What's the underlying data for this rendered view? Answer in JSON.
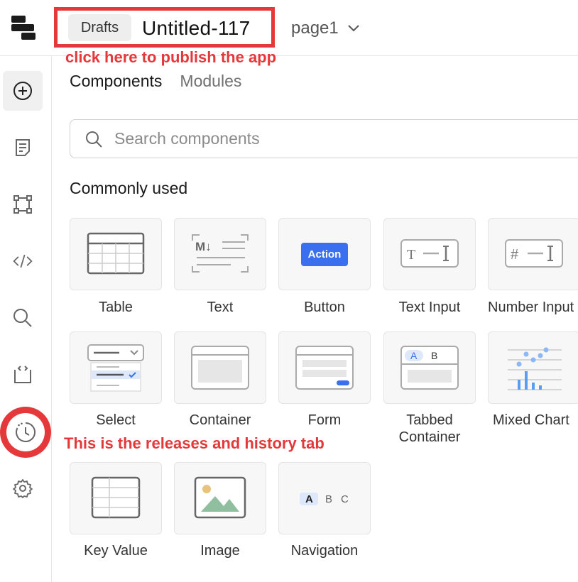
{
  "header": {
    "drafts_label": "Drafts",
    "app_title": "Untitled-117",
    "page_name": "page1"
  },
  "annotations": {
    "publish_note": "click here to publish the app",
    "history_note": "This is the releases and history tab"
  },
  "sidebar": {
    "items": [
      {
        "icon": "add-circle-icon"
      },
      {
        "icon": "document-icon"
      },
      {
        "icon": "bounding-box-icon"
      },
      {
        "icon": "code-icon"
      },
      {
        "icon": "search-icon"
      },
      {
        "icon": "code-file-icon"
      },
      {
        "icon": "history-icon"
      },
      {
        "icon": "gear-icon"
      }
    ]
  },
  "panel": {
    "tabs": [
      "Components",
      "Modules"
    ],
    "search_placeholder": "Search components",
    "section_title": "Commonly used",
    "components": [
      {
        "label": "Table",
        "icon": "table-icon"
      },
      {
        "label": "Text",
        "icon": "markdown-text-icon"
      },
      {
        "label": "Button",
        "icon": "button-icon",
        "button_text": "Action"
      },
      {
        "label": "Text Input",
        "icon": "text-input-icon"
      },
      {
        "label": "Number Input",
        "icon": "number-input-icon"
      },
      {
        "label": "Select",
        "icon": "select-icon"
      },
      {
        "label": "Container",
        "icon": "container-icon"
      },
      {
        "label": "Form",
        "icon": "form-icon"
      },
      {
        "label": "Tabbed",
        "label2": "Container",
        "icon": "tabbed-container-icon",
        "tab_a": "A",
        "tab_b": "B"
      },
      {
        "label": "Mixed Chart",
        "icon": "mixed-chart-icon"
      },
      {
        "label": "Key Value",
        "icon": "key-value-icon"
      },
      {
        "label": "Image",
        "icon": "image-icon"
      },
      {
        "label": "Navigation",
        "icon": "navigation-icon",
        "nav_a": "A",
        "nav_b": "B",
        "nav_c": "C"
      }
    ]
  },
  "colors": {
    "accent_red": "#e5383b",
    "button_blue": "#3a6ff0",
    "chart_blue": "#5b9bf0"
  }
}
